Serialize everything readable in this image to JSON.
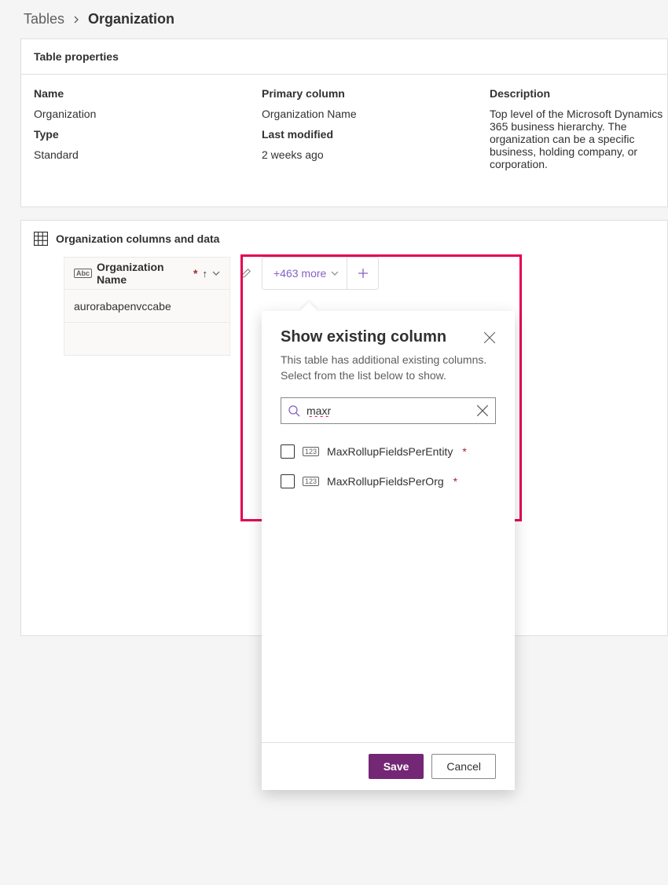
{
  "breadcrumb": {
    "parent": "Tables",
    "current": "Organization"
  },
  "properties_header": "Table properties",
  "props": {
    "labels": {
      "name": "Name",
      "type": "Type",
      "primary": "Primary column",
      "modified": "Last modified",
      "description": "Description"
    },
    "name": "Organization",
    "type": "Standard",
    "primary": "Organization Name",
    "modified": "2 weeks ago",
    "description": "Top level of the Microsoft Dynamics 365 business hierarchy. The organization can be a specific business, holding company, or corporation."
  },
  "columns_section_title": "Organization columns and data",
  "grid": {
    "column_header": "Organization Name",
    "row1": "aurorabapenvccabe",
    "more_count": "+463 more"
  },
  "flyout": {
    "title": "Show existing column",
    "subtitle_line1": "This table has additional existing columns.",
    "subtitle_line2": "Select from the list below to show.",
    "search_value": "maxr",
    "options": [
      {
        "label": "MaxRollupFieldsPerEntity"
      },
      {
        "label": "MaxRollupFieldsPerOrg"
      }
    ],
    "save": "Save",
    "cancel": "Cancel"
  }
}
